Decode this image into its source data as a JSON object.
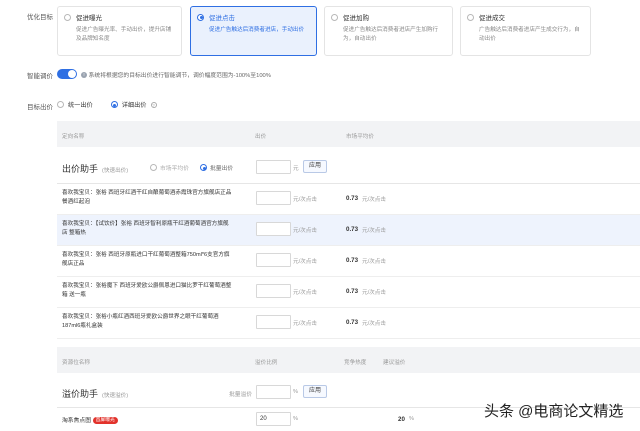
{
  "labels": {
    "opt_goal": "优化目标",
    "smart_bid": "智能调价",
    "target_bid": "目标出价"
  },
  "cards": [
    {
      "title": "促进曝光",
      "desc": "促进广告曝光率、手动出价，提升店铺及品牌知名度",
      "selected": false
    },
    {
      "title": "促进点击",
      "desc": "促进广告触达后消费者进店，手动出价",
      "selected": true
    },
    {
      "title": "促进加购",
      "desc": "促进广告触达后消费者进店产生加购行为，自动出价",
      "selected": false
    },
    {
      "title": "促进成交",
      "desc": "广告触达后消费者进店产生成交行为，自动出价",
      "selected": false
    }
  ],
  "smart_desc": "系统将根据您的目标出价进行智能调节，调价幅度范围为-100%至100%",
  "bid_modes": {
    "uniform": "统一出价",
    "detail": "详细出价"
  },
  "table1": {
    "headers": [
      "定向名称",
      "出价",
      "市场平均价"
    ],
    "assistant": {
      "title": "出价助手",
      "sub": "(快速出价)",
      "opt_market": "市场平均价",
      "opt_batch": "批量出价",
      "unit": "元",
      "apply": "应用"
    },
    "rows": [
      {
        "name": "喜欢我宝贝：张裕 西班牙红酒干红自酿葡萄酒赤霞珠官方旗舰店正品餐酒红起泡",
        "unit": "元/次点击",
        "avg": "0.73",
        "avg_unit": "元/次点击"
      },
      {
        "name": "喜欢我宝贝：【试饮价】张裕 西班牙智利原瓶干红酒葡萄酒官方旗舰店 整箱热",
        "unit": "元/次点击",
        "avg": "0.73",
        "avg_unit": "元/次点击"
      },
      {
        "name": "喜欢我宝贝：张裕 西班牙原瓶进口干红葡萄酒整箱750ml*6支官方旗舰店正品",
        "unit": "元/次点击",
        "avg": "0.73",
        "avg_unit": "元/次点击"
      },
      {
        "name": "喜欢我宝贝：张裕魔下 西班牙爱欧公爵佩恩进口猫比罗干红葡萄酒整箱 送一瓶",
        "unit": "元/次点击",
        "avg": "0.73",
        "avg_unit": "元/次点击"
      },
      {
        "name": "喜欢我宝贝：张裕小瓶红酒西班牙爱欧公爵世界之眼干红葡萄酒187ml6瓶礼盒装",
        "unit": "元/次点击",
        "avg": "0.73",
        "avg_unit": "元/次点击"
      }
    ]
  },
  "table2": {
    "headers": [
      "资源位名称",
      "溢价比例",
      "竞争热度",
      "建议溢价"
    ],
    "assistant": {
      "title": "溢价助手",
      "sub": "(快速溢价)",
      "batch": "批量溢价",
      "unit": "%",
      "apply": "应用"
    },
    "rows": [
      {
        "name": "淘系焦点图",
        "badge": "首屏曝光",
        "value": "20",
        "unit": "%",
        "suggest": "20",
        "suggest_unit": "%"
      }
    ]
  },
  "watermark": "头条 @电商论文精选"
}
